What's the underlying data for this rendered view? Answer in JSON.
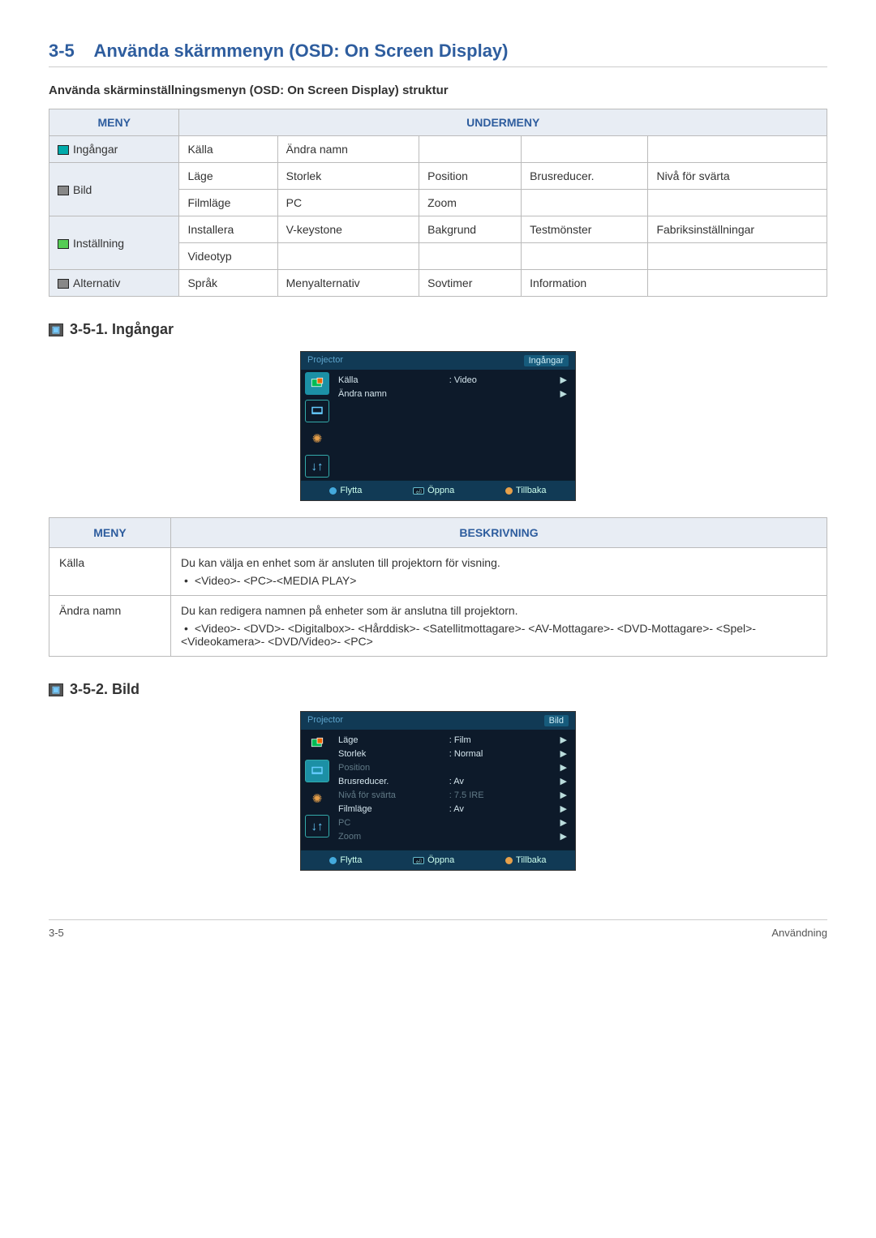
{
  "section": {
    "number": "3-5",
    "title": "Använda skärmmenyn (OSD: On Screen Display)",
    "subtitle": "Använda skärminställningsmenyn (OSD: On Screen Display) struktur"
  },
  "struct_table": {
    "headers": {
      "menu": "MENY",
      "submenu": "UNDERMENY"
    },
    "rows": [
      {
        "menu": "Ingångar",
        "cells": [
          "Källa",
          "Ändra namn",
          "",
          "",
          ""
        ]
      },
      {
        "menu": "Bild",
        "cells": [
          "Läge",
          "Storlek",
          "Position",
          "Brusreducer.",
          "Nivå för svärta"
        ]
      },
      {
        "menu": "",
        "cells": [
          "Filmläge",
          "PC",
          "Zoom",
          "",
          ""
        ]
      },
      {
        "menu": "Inställning",
        "cells": [
          "Installera",
          "V-keystone",
          "Bakgrund",
          "Testmönster",
          "Fabriksinställ­ningar"
        ]
      },
      {
        "menu": "",
        "cells": [
          "Videotyp",
          "",
          "",
          "",
          ""
        ]
      },
      {
        "menu": "Alternativ",
        "cells": [
          "Språk",
          "Menyalternativ",
          "Sovtimer",
          "Information",
          ""
        ]
      }
    ]
  },
  "section_351": {
    "heading": "3-5-1. Ingångar",
    "osd": {
      "left": "Projector",
      "right": "Ingångar",
      "rows": [
        {
          "label": "Källa",
          "value": ": Video"
        },
        {
          "label": "Ändra namn",
          "value": ""
        }
      ],
      "footer": {
        "move": "Flytta",
        "open": "Öppna",
        "back": "Tillbaka"
      }
    },
    "desc_headers": {
      "menu": "MENY",
      "desc": "BESKRIVNING"
    },
    "desc_rows": [
      {
        "menu": "Källa",
        "text": "Du kan välja en enhet som är ansluten till projektorn för visning.",
        "bullet": "<Video>- <PC>-<MEDIA PLAY>"
      },
      {
        "menu": "Ändra namn",
        "text": "Du kan redigera namnen på enheter som är anslutna till projektorn.",
        "bullet": "<Video>- <DVD>- <Digitalbox>- <Hårddisk>- <Satellitmottagare>- <AV-Mottagare>- <DVD-Mottagare>- <Spel>- <Videokamera>- <DVD/Video>- <PC>"
      }
    ]
  },
  "section_352": {
    "heading": "3-5-2. Bild",
    "osd": {
      "left": "Projector",
      "right": "Bild",
      "rows": [
        {
          "label": "Läge",
          "value": ": Film",
          "dim": false
        },
        {
          "label": "Storlek",
          "value": ": Normal",
          "dim": false
        },
        {
          "label": "Position",
          "value": "",
          "dim": true
        },
        {
          "label": "Brusreducer.",
          "value": ": Av",
          "dim": false
        },
        {
          "label": "Nivå för svärta",
          "value": ": 7.5 IRE",
          "dim": true
        },
        {
          "label": "Filmläge",
          "value": ": Av",
          "dim": false
        },
        {
          "label": "PC",
          "value": "",
          "dim": true
        },
        {
          "label": "Zoom",
          "value": "",
          "dim": true
        }
      ],
      "footer": {
        "move": "Flytta",
        "open": "Öppna",
        "back": "Tillbaka"
      }
    }
  },
  "footer": {
    "left": "3-5",
    "right": "Användning"
  }
}
